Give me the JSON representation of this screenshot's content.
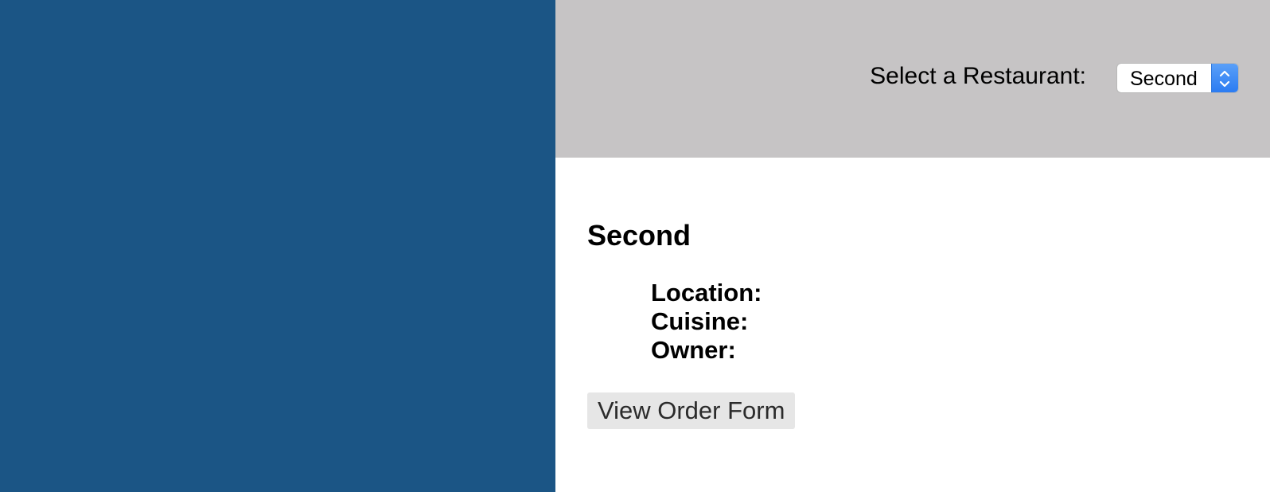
{
  "header": {
    "select_label": "Select a Restaurant:",
    "selected_restaurant": "Second",
    "select_icon": "chevron-up-down-icon"
  },
  "restaurant": {
    "name": "Second",
    "details": [
      {
        "label": "Location:"
      },
      {
        "label": "Cuisine:"
      },
      {
        "label": "Owner:"
      }
    ],
    "order_button_label": "View Order Form"
  },
  "colors": {
    "left_panel": "#1b5585",
    "header_background": "#c6c4c5",
    "content_background": "#ffffff",
    "button_background": "#e6e6e6",
    "select_accent": "#2b7cf2"
  }
}
